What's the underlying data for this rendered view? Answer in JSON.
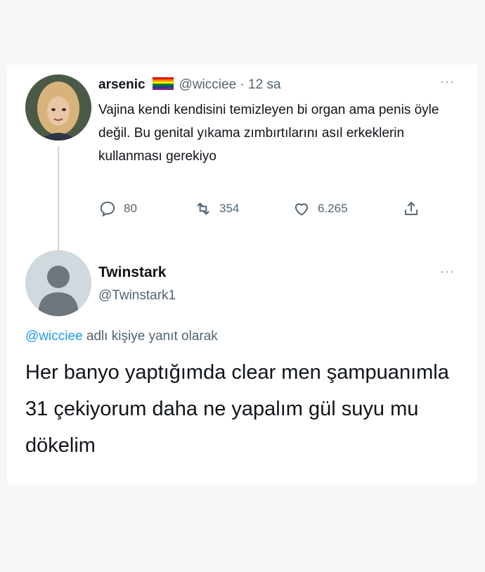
{
  "tweet": {
    "author_name": "arsenic",
    "handle": "@wicciee",
    "time": "· 12 sa",
    "text": "Vajina kendi kendisini temizleyen bi organ ama penis öyle değil. Bu genital yıkama zımbırtılarını asıl erkeklerin kullanması gerekiyo",
    "replies": "80",
    "retweets": "354",
    "likes": "6.265"
  },
  "reply": {
    "author_name": "Twinstark",
    "handle": "@Twinstark1",
    "replying_to_handle": "@wicciee",
    "replying_to_suffix": " adlı kişiye yanıt olarak",
    "text": "Her banyo yaptığımda clear men şampuanımla 31 çekiyorum daha ne yapalım gül suyu mu dökelim"
  },
  "icons": [
    "reply-icon",
    "retweet-icon",
    "like-icon",
    "share-icon",
    "more-icon"
  ]
}
